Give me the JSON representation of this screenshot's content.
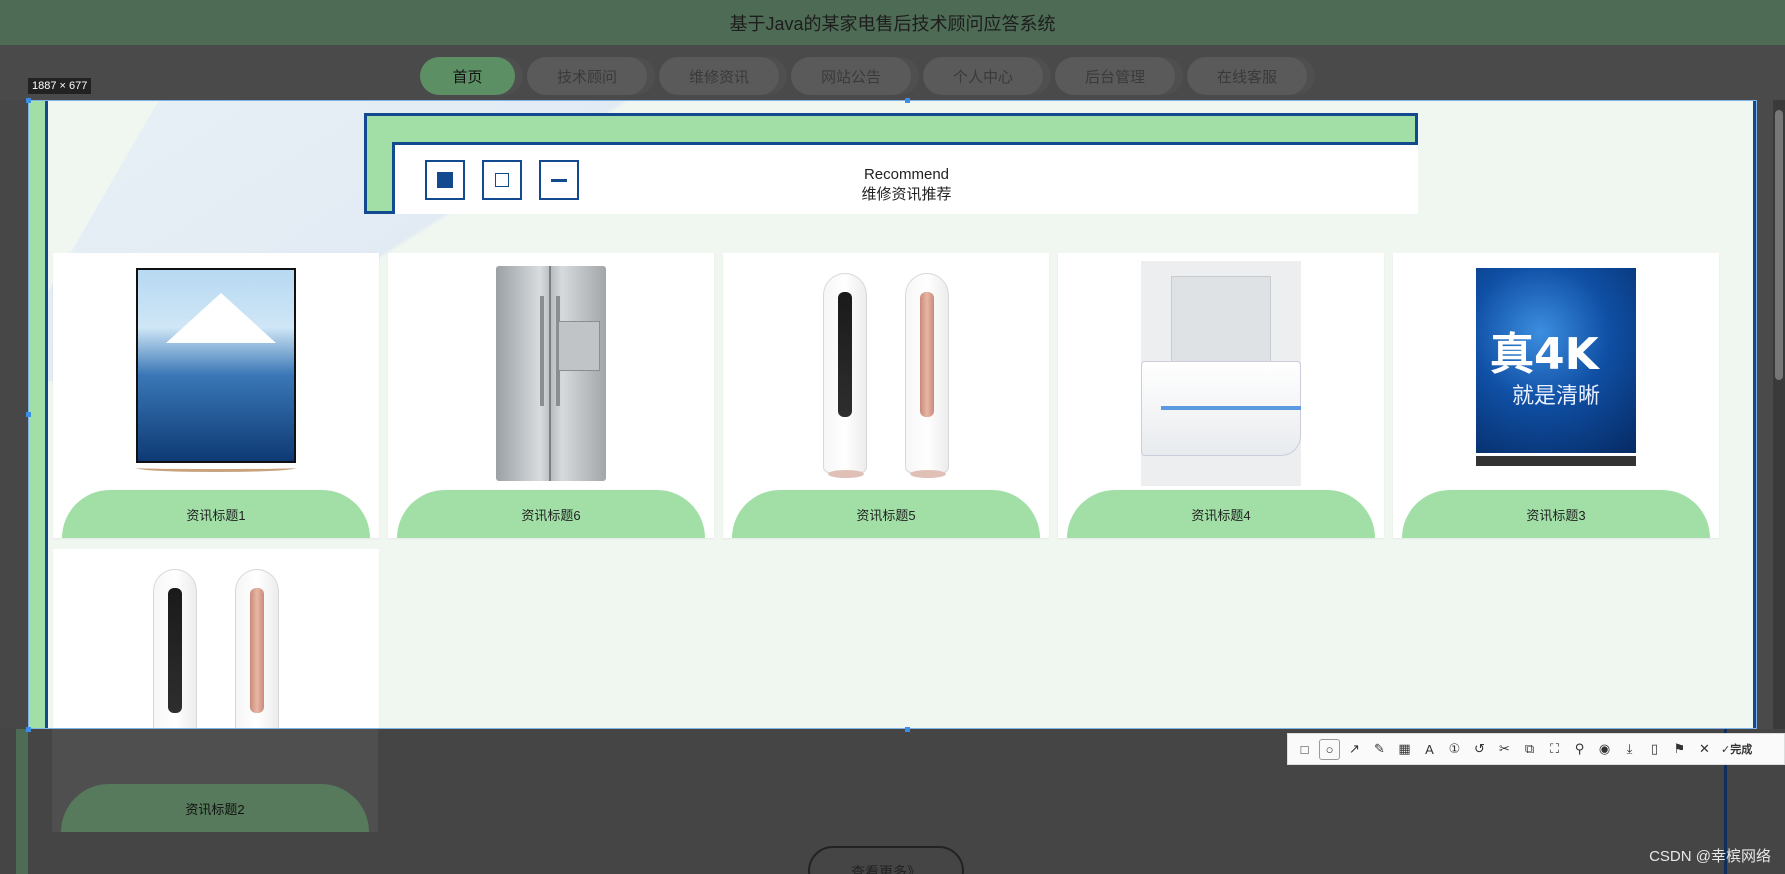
{
  "header": {
    "title": "基于Java的某家电售后技术顾问应答系统"
  },
  "nav": {
    "items": [
      {
        "label": "首页",
        "width": 95
      },
      {
        "label": "技术顾问",
        "width": 120
      },
      {
        "label": "维修资讯",
        "width": 120
      },
      {
        "label": "网站公告",
        "width": 120
      },
      {
        "label": "个人中心",
        "width": 120
      },
      {
        "label": "后台管理",
        "width": 120
      },
      {
        "label": "在线客服",
        "width": 120
      }
    ]
  },
  "selection": {
    "size_label": "1887 × 677"
  },
  "recommend": {
    "en": "Recommend",
    "cn": "维修资讯推荐"
  },
  "cards": [
    {
      "label": "资讯标题1",
      "image": "tv-lake-swan"
    },
    {
      "label": "资讯标题6",
      "image": "fridge-double-door"
    },
    {
      "label": "资讯标题5",
      "image": "ac-tower-pair"
    },
    {
      "label": "资讯标题4",
      "image": "ac-wall-unit"
    },
    {
      "label": "资讯标题3",
      "image": "tv-4k"
    },
    {
      "label": "资讯标题2",
      "image": "ac-tower-pair"
    }
  ],
  "tv4k": {
    "line1": "真4K",
    "line2": "就是清晰"
  },
  "more_button": "查看更多》",
  "toolbar": {
    "done_label": "完成"
  },
  "watermark": "CSDN @幸槟网络"
}
